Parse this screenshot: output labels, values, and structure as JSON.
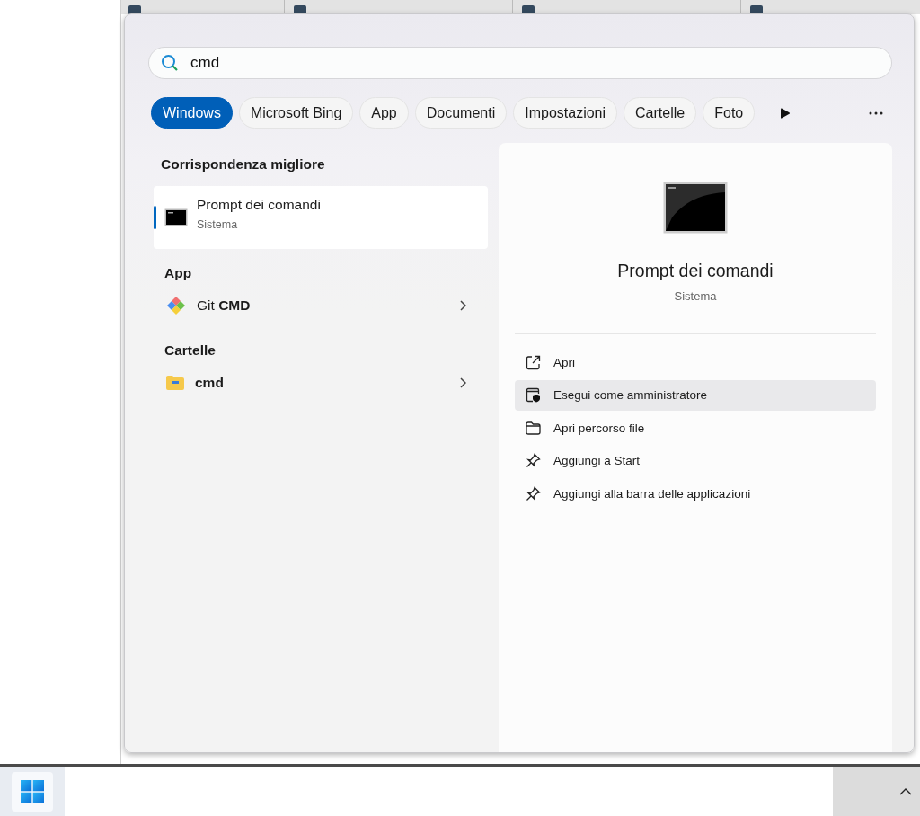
{
  "search": {
    "value": "cmd"
  },
  "filters": [
    {
      "label": "Windows",
      "selected": true
    },
    {
      "label": "Microsoft Bing",
      "selected": false
    },
    {
      "label": "App",
      "selected": false
    },
    {
      "label": "Documenti",
      "selected": false
    },
    {
      "label": "Impostazioni",
      "selected": false
    },
    {
      "label": "Cartelle",
      "selected": false
    },
    {
      "label": "Foto",
      "selected": false
    }
  ],
  "best_match": {
    "heading": "Corrispondenza migliore",
    "title": "Prompt dei comandi",
    "subtitle": "Sistema",
    "selected": true
  },
  "sections": [
    {
      "heading": "App",
      "items": [
        {
          "kind": "app",
          "label": "Git **CMD**",
          "bold": false
        }
      ]
    },
    {
      "heading": "Cartelle",
      "items": [
        {
          "kind": "folder",
          "label": "cmd",
          "bold": true
        }
      ]
    }
  ],
  "detail": {
    "title": "Prompt dei comandi",
    "subtitle": "Sistema",
    "actions": [
      {
        "kind": "open",
        "label": "Apri",
        "selected": false
      },
      {
        "kind": "admin",
        "label": "Esegui come amministratore",
        "selected": true
      },
      {
        "kind": "folder",
        "label": "Apri percorso file",
        "selected": false
      },
      {
        "kind": "pin",
        "label": "Aggiungi a Start",
        "selected": false
      },
      {
        "kind": "pin",
        "label": "Aggiungi alla barra delle applicazioni",
        "selected": false
      }
    ]
  }
}
